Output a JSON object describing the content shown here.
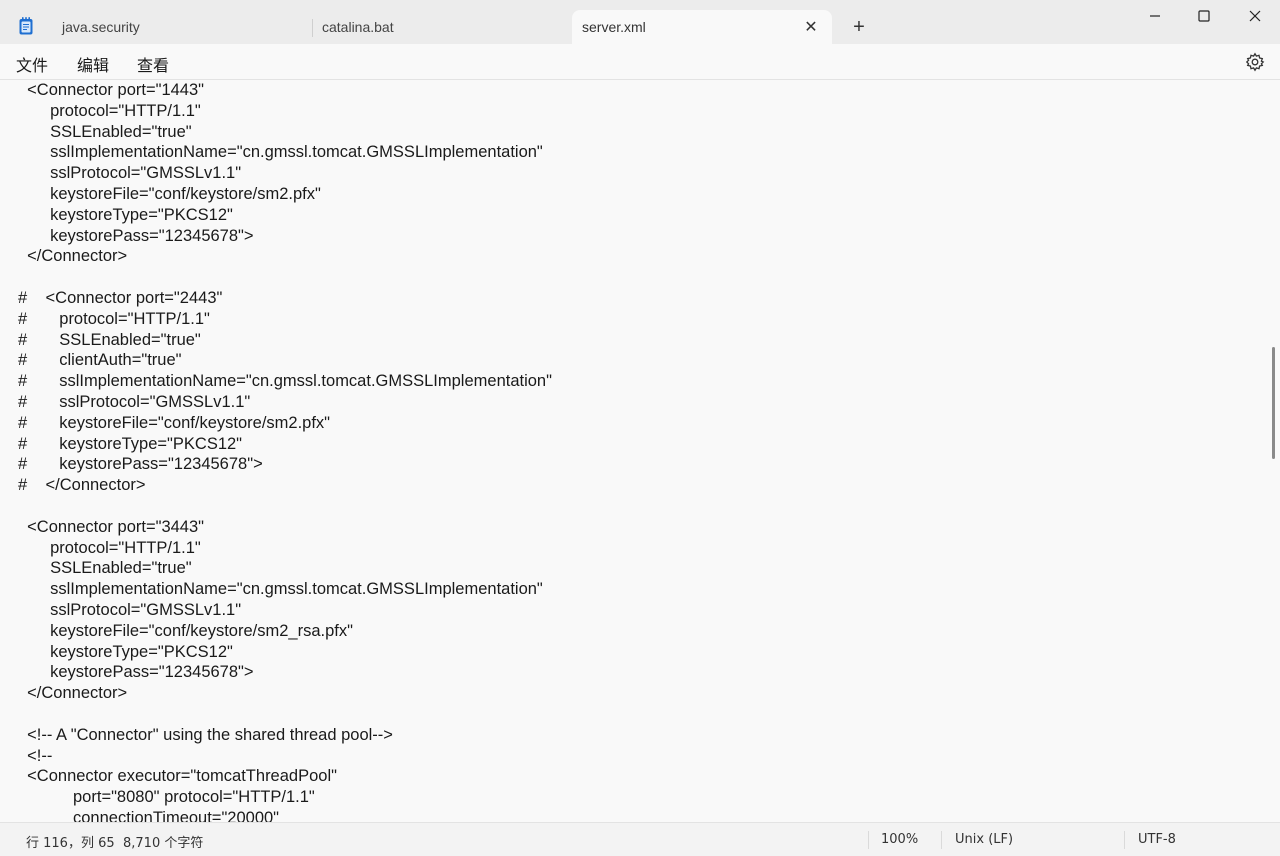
{
  "tabs": [
    {
      "label": "java.security",
      "active": false
    },
    {
      "label": "catalina.bat",
      "active": false
    },
    {
      "label": "server.xml",
      "active": true
    }
  ],
  "tab_close_glyph": "✕",
  "new_tab_glyph": "+",
  "menu": {
    "file": "文件",
    "edit": "编辑",
    "view": "查看"
  },
  "code_lines": [
    "  <Connector port=\"1443\"",
    "       protocol=\"HTTP/1.1\"",
    "       SSLEnabled=\"true\"",
    "       sslImplementationName=\"cn.gmssl.tomcat.GMSSLImplementation\"",
    "       sslProtocol=\"GMSSLv1.1\"",
    "       keystoreFile=\"conf/keystore/sm2.pfx\"",
    "       keystoreType=\"PKCS12\"",
    "       keystorePass=\"12345678\">",
    "  </Connector>",
    "",
    "#    <Connector port=\"2443\"",
    "#       protocol=\"HTTP/1.1\"",
    "#       SSLEnabled=\"true\"",
    "#       clientAuth=\"true\"",
    "#       sslImplementationName=\"cn.gmssl.tomcat.GMSSLImplementation\"",
    "#       sslProtocol=\"GMSSLv1.1\"",
    "#       keystoreFile=\"conf/keystore/sm2.pfx\"",
    "#       keystoreType=\"PKCS12\"",
    "#       keystorePass=\"12345678\">",
    "#    </Connector>",
    "",
    "  <Connector port=\"3443\"",
    "       protocol=\"HTTP/1.1\"",
    "       SSLEnabled=\"true\"",
    "       sslImplementationName=\"cn.gmssl.tomcat.GMSSLImplementation\"",
    "       sslProtocol=\"GMSSLv1.1\"",
    "       keystoreFile=\"conf/keystore/sm2_rsa.pfx\"",
    "       keystoreType=\"PKCS12\"",
    "       keystorePass=\"12345678\">",
    "  </Connector>",
    "",
    "  <!-- A \"Connector\" using the shared thread pool-->",
    "  <!--",
    "  <Connector executor=\"tomcatThreadPool\"",
    "            port=\"8080\" protocol=\"HTTP/1.1\"",
    "            connectionTimeout=\"20000\""
  ],
  "status": {
    "position": "行 116，列 65",
    "char_count": "8,710 个字符",
    "zoom": "100%",
    "line_ending": "Unix (LF)",
    "encoding": "UTF-8"
  },
  "icons": {
    "app": "notepad-icon",
    "settings": "gear-icon",
    "minimize": "minimize-icon",
    "maximize": "maximize-icon",
    "close": "close-icon"
  },
  "colors": {
    "tab_bar": "#ececec",
    "editor_bg": "#f9f9f9",
    "app_icon": "#1f6fd1"
  }
}
